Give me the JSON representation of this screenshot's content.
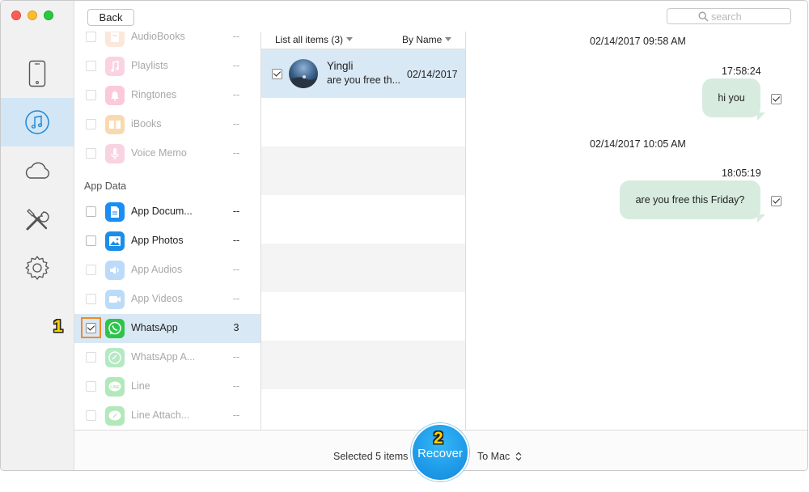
{
  "window": {
    "back_label": "Back",
    "search_placeholder": "search"
  },
  "nav": {
    "items": [
      {
        "name": "device-icon",
        "active": false
      },
      {
        "name": "music-icon",
        "active": true
      },
      {
        "name": "cloud-icon",
        "active": false
      },
      {
        "name": "tools-icon",
        "active": false
      },
      {
        "name": "settings-icon",
        "active": false
      }
    ]
  },
  "categories": {
    "top_items": [
      {
        "label": "AudioBooks",
        "count": "--",
        "enabled": false,
        "checked": false,
        "icon": "audiobooks-icon"
      },
      {
        "label": "Playlists",
        "count": "--",
        "enabled": false,
        "checked": false,
        "icon": "playlists-icon"
      },
      {
        "label": "Ringtones",
        "count": "--",
        "enabled": false,
        "checked": false,
        "icon": "ringtones-icon"
      },
      {
        "label": "iBooks",
        "count": "--",
        "enabled": false,
        "checked": false,
        "icon": "ibooks-icon"
      },
      {
        "label": "Voice Memo",
        "count": "--",
        "enabled": false,
        "checked": false,
        "icon": "voice-memo-icon"
      }
    ],
    "section_label": "App Data",
    "app_items": [
      {
        "label": "App Docum...",
        "count": "--",
        "enabled": true,
        "checked": false,
        "icon": "app-documents-icon"
      },
      {
        "label": "App Photos",
        "count": "--",
        "enabled": true,
        "checked": false,
        "icon": "app-photos-icon"
      },
      {
        "label": "App Audios",
        "count": "--",
        "enabled": false,
        "checked": false,
        "icon": "app-audios-icon"
      },
      {
        "label": "App Videos",
        "count": "--",
        "enabled": false,
        "checked": false,
        "icon": "app-videos-icon"
      },
      {
        "label": "WhatsApp",
        "count": "3",
        "enabled": true,
        "checked": true,
        "selected": true,
        "icon": "whatsapp-icon"
      },
      {
        "label": "WhatsApp A...",
        "count": "--",
        "enabled": false,
        "checked": false,
        "icon": "whatsapp-attachments-icon"
      },
      {
        "label": "Line",
        "count": "--",
        "enabled": false,
        "checked": false,
        "icon": "line-icon"
      },
      {
        "label": "Line Attach...",
        "count": "--",
        "enabled": false,
        "checked": false,
        "icon": "line-attachments-icon"
      }
    ]
  },
  "items": {
    "list_label": "List all items (3)",
    "sort_label": "By Name",
    "chats": [
      {
        "name": "Yingli",
        "preview": "are you free th...",
        "date": "02/14/2017",
        "checked": true
      }
    ]
  },
  "messages": [
    {
      "type": "date",
      "text": "02/14/2017 09:58 AM"
    },
    {
      "type": "time",
      "text": "17:58:24"
    },
    {
      "type": "bubble",
      "text": "hi you",
      "checked": true
    },
    {
      "type": "date",
      "text": "02/14/2017 10:05 AM"
    },
    {
      "type": "time",
      "text": "18:05:19"
    },
    {
      "type": "bubble",
      "text": "are you free this Friday?",
      "checked": true
    }
  ],
  "bottom": {
    "selected_text": "Selected 5 items",
    "recover_label": "Recover",
    "destination_label": "To Mac",
    "destination_icon": "updown-chevron-icon"
  },
  "annotations": {
    "step1": "1",
    "step2": "2"
  },
  "colors": {
    "accent": "#1e9ae8",
    "selection": "#d9e8f5",
    "bubble": "#d7ebdf",
    "highlight_box": "#f28a26",
    "step_label": "#ffd200"
  }
}
